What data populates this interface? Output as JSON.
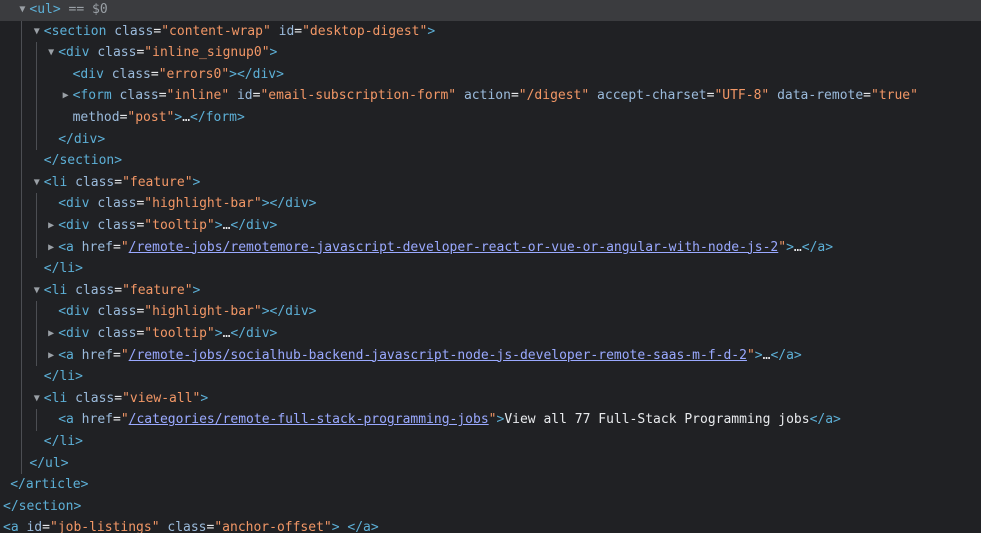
{
  "colors": {
    "background": "#202124",
    "selected_row": "#3b3c3f",
    "tag": "#5db0d7",
    "attribute_name": "#9bbbdc",
    "attribute_value": "#f29766",
    "link": "#9aa9ff",
    "text": "#e8eaed"
  },
  "selection_marker": "== $0",
  "rows": [
    {
      "indent": 1,
      "toggle": "open",
      "selected": true,
      "parts": [
        [
          "tag",
          "<ul>"
        ],
        [
          "dim",
          " == $0"
        ]
      ]
    },
    {
      "indent": 2,
      "toggle": "open",
      "parts": [
        [
          "tag",
          "<section"
        ],
        [
          "attr",
          " class"
        ],
        [
          "eq",
          "="
        ],
        [
          "val",
          "\"content-wrap\""
        ],
        [
          "attr",
          " id"
        ],
        [
          "eq",
          "="
        ],
        [
          "val",
          "\"desktop-digest\""
        ],
        [
          "tag",
          ">"
        ]
      ]
    },
    {
      "indent": 3,
      "toggle": "open",
      "parts": [
        [
          "tag",
          "<div"
        ],
        [
          "attr",
          " class"
        ],
        [
          "eq",
          "="
        ],
        [
          "val",
          "\"inline_signup0\""
        ],
        [
          "tag",
          ">"
        ]
      ]
    },
    {
      "indent": 4,
      "toggle": "",
      "parts": [
        [
          "tag",
          "<div"
        ],
        [
          "attr",
          " class"
        ],
        [
          "eq",
          "="
        ],
        [
          "val",
          "\"errors0\""
        ],
        [
          "tag",
          "></div>"
        ]
      ]
    },
    {
      "indent": 4,
      "toggle": "closed",
      "parts": [
        [
          "tag",
          "<form"
        ],
        [
          "attr",
          " class"
        ],
        [
          "eq",
          "="
        ],
        [
          "val",
          "\"inline\""
        ],
        [
          "attr",
          " id"
        ],
        [
          "eq",
          "="
        ],
        [
          "val",
          "\"email-subscription-form\""
        ],
        [
          "attr",
          " action"
        ],
        [
          "eq",
          "="
        ],
        [
          "val",
          "\"/digest\""
        ],
        [
          "attr",
          " accept-charset"
        ],
        [
          "eq",
          "="
        ],
        [
          "val",
          "\"UTF-8\""
        ],
        [
          "attr",
          " data-remote"
        ],
        [
          "eq",
          "="
        ],
        [
          "val",
          "\"true\""
        ]
      ]
    },
    {
      "indent": 4,
      "toggle": "",
      "parts": [
        [
          "attr",
          "method"
        ],
        [
          "eq",
          "="
        ],
        [
          "val",
          "\"post\""
        ],
        [
          "tag",
          ">"
        ],
        [
          "txt",
          "…"
        ],
        [
          "tag",
          "</form>"
        ]
      ]
    },
    {
      "indent": 3,
      "toggle": "",
      "parts": [
        [
          "tag",
          "</div>"
        ]
      ]
    },
    {
      "indent": 2,
      "toggle": "",
      "parts": [
        [
          "tag",
          "</section>"
        ]
      ]
    },
    {
      "indent": 2,
      "toggle": "open",
      "parts": [
        [
          "tag",
          "<li"
        ],
        [
          "attr",
          " class"
        ],
        [
          "eq",
          "="
        ],
        [
          "val",
          "\"feature\""
        ],
        [
          "tag",
          ">"
        ]
      ]
    },
    {
      "indent": 3,
      "toggle": "",
      "parts": [
        [
          "tag",
          "<div"
        ],
        [
          "attr",
          " class"
        ],
        [
          "eq",
          "="
        ],
        [
          "val",
          "\"highlight-bar\""
        ],
        [
          "tag",
          "></div>"
        ]
      ]
    },
    {
      "indent": 3,
      "toggle": "closed",
      "parts": [
        [
          "tag",
          "<div"
        ],
        [
          "attr",
          " class"
        ],
        [
          "eq",
          "="
        ],
        [
          "val",
          "\"tooltip\""
        ],
        [
          "tag",
          ">"
        ],
        [
          "txt",
          "…"
        ],
        [
          "tag",
          "</div>"
        ]
      ]
    },
    {
      "indent": 3,
      "toggle": "closed",
      "parts": [
        [
          "tag",
          "<a"
        ],
        [
          "attr",
          " href"
        ],
        [
          "eq",
          "="
        ],
        [
          "val",
          "\""
        ],
        [
          "link",
          "/remote-jobs/remotemore-javascript-developer-react-or-vue-or-angular-with-node-js-2"
        ],
        [
          "val",
          "\""
        ],
        [
          "tag",
          ">"
        ],
        [
          "txt",
          "…"
        ],
        [
          "tag",
          "</a>"
        ]
      ]
    },
    {
      "indent": 2,
      "toggle": "",
      "parts": [
        [
          "tag",
          "</li>"
        ]
      ]
    },
    {
      "indent": 2,
      "toggle": "open",
      "parts": [
        [
          "tag",
          "<li"
        ],
        [
          "attr",
          " class"
        ],
        [
          "eq",
          "="
        ],
        [
          "val",
          "\"feature\""
        ],
        [
          "tag",
          ">"
        ]
      ]
    },
    {
      "indent": 3,
      "toggle": "",
      "parts": [
        [
          "tag",
          "<div"
        ],
        [
          "attr",
          " class"
        ],
        [
          "eq",
          "="
        ],
        [
          "val",
          "\"highlight-bar\""
        ],
        [
          "tag",
          "></div>"
        ]
      ]
    },
    {
      "indent": 3,
      "toggle": "closed",
      "parts": [
        [
          "tag",
          "<div"
        ],
        [
          "attr",
          " class"
        ],
        [
          "eq",
          "="
        ],
        [
          "val",
          "\"tooltip\""
        ],
        [
          "tag",
          ">"
        ],
        [
          "txt",
          "…"
        ],
        [
          "tag",
          "</div>"
        ]
      ]
    },
    {
      "indent": 3,
      "toggle": "closed",
      "parts": [
        [
          "tag",
          "<a"
        ],
        [
          "attr",
          " href"
        ],
        [
          "eq",
          "="
        ],
        [
          "val",
          "\""
        ],
        [
          "link",
          "/remote-jobs/socialhub-backend-javascript-node-js-developer-remote-saas-m-f-d-2"
        ],
        [
          "val",
          "\""
        ],
        [
          "tag",
          ">"
        ],
        [
          "txt",
          "…"
        ],
        [
          "tag",
          "</a>"
        ]
      ]
    },
    {
      "indent": 2,
      "toggle": "",
      "parts": [
        [
          "tag",
          "</li>"
        ]
      ]
    },
    {
      "indent": 2,
      "toggle": "open",
      "parts": [
        [
          "tag",
          "<li"
        ],
        [
          "attr",
          " class"
        ],
        [
          "eq",
          "="
        ],
        [
          "val",
          "\"view-all\""
        ],
        [
          "tag",
          ">"
        ]
      ]
    },
    {
      "indent": 3,
      "toggle": "",
      "parts": [
        [
          "tag",
          "<a"
        ],
        [
          "attr",
          " href"
        ],
        [
          "eq",
          "="
        ],
        [
          "val",
          "\""
        ],
        [
          "link",
          "/categories/remote-full-stack-programming-jobs"
        ],
        [
          "val",
          "\""
        ],
        [
          "tag",
          ">"
        ],
        [
          "txt",
          "View all 77 Full-Stack Programming jobs"
        ],
        [
          "tag",
          "</a>"
        ]
      ]
    },
    {
      "indent": 2,
      "toggle": "",
      "parts": [
        [
          "tag",
          "</li>"
        ]
      ]
    },
    {
      "indent": 1,
      "toggle": "",
      "parts": [
        [
          "tag",
          "</ul>"
        ]
      ]
    },
    {
      "indent": 0.5,
      "toggle": "",
      "parts": [
        [
          "tag",
          "</article>"
        ]
      ]
    },
    {
      "indent": 0,
      "toggle": "",
      "parts": [
        [
          "tag",
          "</section>"
        ]
      ]
    },
    {
      "indent": 0,
      "toggle": "",
      "parts": [
        [
          "tag",
          "<a"
        ],
        [
          "attr",
          " id"
        ],
        [
          "eq",
          "="
        ],
        [
          "val",
          "\"job-listings\""
        ],
        [
          "attr",
          " class"
        ],
        [
          "eq",
          "="
        ],
        [
          "val",
          "\"anchor-offset\""
        ],
        [
          "tag",
          ">"
        ],
        [
          "txt",
          " "
        ],
        [
          "tag",
          "</a>"
        ]
      ]
    }
  ]
}
